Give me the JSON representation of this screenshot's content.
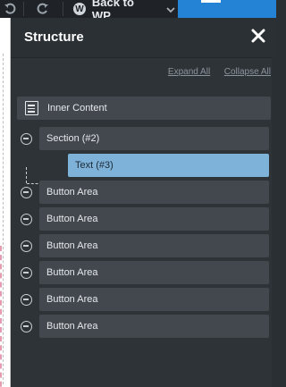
{
  "toolbar": {
    "undo_icon": "undo-icon",
    "redo_icon": "redo-icon",
    "back_label": "Back to WP",
    "wp_icon": "wordpress-icon",
    "caret_icon": "chevron-down-icon",
    "menu_icon": "hamburger-icon"
  },
  "panel": {
    "title": "Structure",
    "close_icon": "close-icon",
    "expand_all": "Expand All",
    "collapse_all": "Collapse All"
  },
  "items": [
    {
      "label": "Inner Content",
      "icon": "document-icon"
    },
    {
      "label": "Section (#2)",
      "icon": "collapse-icon"
    },
    {
      "label": "Text (#3)",
      "selected": true
    },
    {
      "label": "Button Area",
      "icon": "collapse-icon"
    },
    {
      "label": "Button Area",
      "icon": "collapse-icon"
    },
    {
      "label": "Button Area",
      "icon": "collapse-icon"
    },
    {
      "label": "Button Area",
      "icon": "collapse-icon"
    },
    {
      "label": "Button Area",
      "icon": "collapse-icon"
    },
    {
      "label": "Button Area",
      "icon": "collapse-icon"
    }
  ],
  "colors": {
    "panel_bg": "#2e3338",
    "row_bg": "#42484e",
    "selected_bg": "#7fb2d9",
    "accent_blue": "#2583d6"
  }
}
